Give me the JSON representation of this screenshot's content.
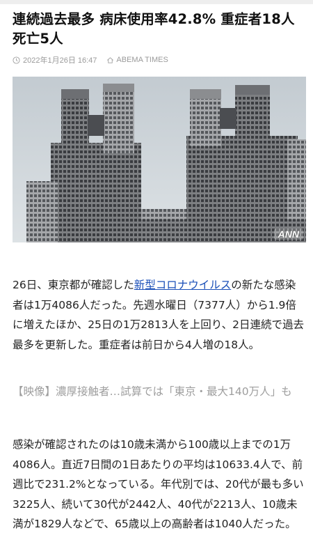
{
  "article": {
    "title": "連続過去最多 病床使用率42.8% 重症者18人 死亡5人",
    "date": "2022年1月26日 16:47",
    "source": "ABEMA TIMES",
    "photo_credit": "ANN",
    "p1_before": "26日、東京都が確認した",
    "p1_link": "新型コロナウイルス",
    "p1_after": "の新たな感染者は1万4086人だった。先週水曜日（7377人）から1.9倍に増えたほか、25日の1万2813人を上回り、2日連続で過去最多を更新した。重症者は前日から4人増の18人。",
    "related": "【映像】濃厚接触者…試算では「東京・最大140万人」も",
    "p2": "感染が確認されたのは10歳未満から100歳以上までの1万4086人。直近7日間の1日あたりの平均は10633.4人で、前週比で231.2%となっている。年代別では、20代が最も多い3225人、続いて30代が2442人、40代が2213人、10歳未満が1829人などで、65歳以上の高齢者は1040人だった。"
  },
  "icons": {
    "clock": "clock-icon",
    "source": "house-icon"
  },
  "colors": {
    "link": "#1a4fb8",
    "meta": "#9a9a9a",
    "related": "#9e9e9e"
  }
}
